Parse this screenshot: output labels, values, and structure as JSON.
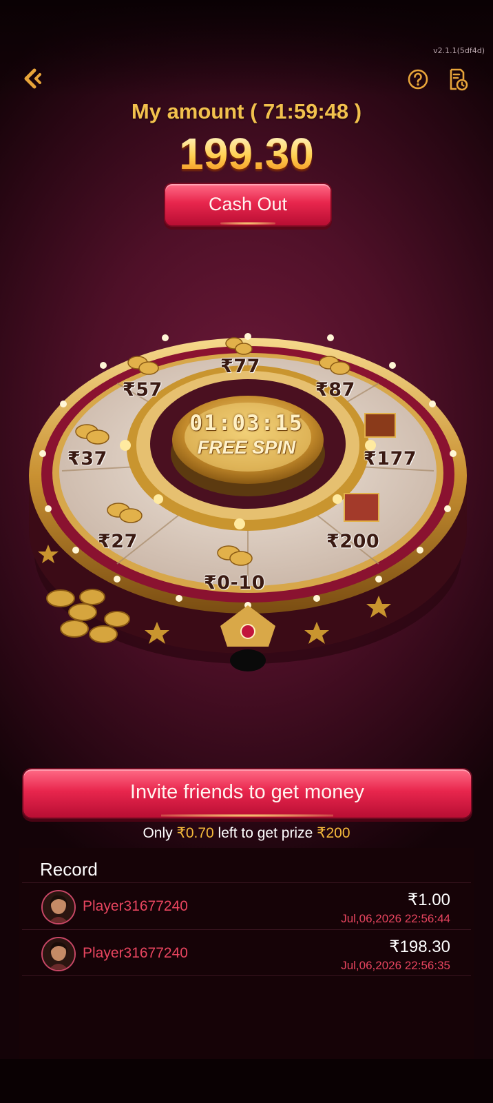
{
  "header": {
    "version": "v2.1.1(5df4d)",
    "back_icon": "chevron-left-icon",
    "help_icon": "question-circle-icon",
    "records_icon": "document-clock-icon",
    "title": "My amount ( 71:59:48 )",
    "amount": "199.30",
    "cashout_label": "Cash Out"
  },
  "wheel": {
    "timer": "01:03:15",
    "center_label": "FREE SPIN",
    "prizes": [
      "₹77",
      "₹87",
      "₹177",
      "₹200",
      "₹0-10",
      "₹27",
      "₹37",
      "₹57"
    ]
  },
  "invite": {
    "button_label": "Invite friends to get money",
    "progress_prefix": "Only ",
    "progress_remaining": "₹0.70",
    "progress_middle": " left to get prize ",
    "progress_prize": "₹200"
  },
  "records": {
    "title": "Record",
    "rows": [
      {
        "player": "Player31677240",
        "amount": "₹1.00",
        "time": "Jul,06,2026 22:56:44"
      },
      {
        "player": "Player31677240",
        "amount": "₹198.30",
        "time": "Jul,06,2026 22:56:35"
      }
    ]
  },
  "colors": {
    "accent_gold": "#f2c14d",
    "button_red": "#e8264d",
    "name_red": "#e8455f",
    "background": "#4f1028"
  }
}
